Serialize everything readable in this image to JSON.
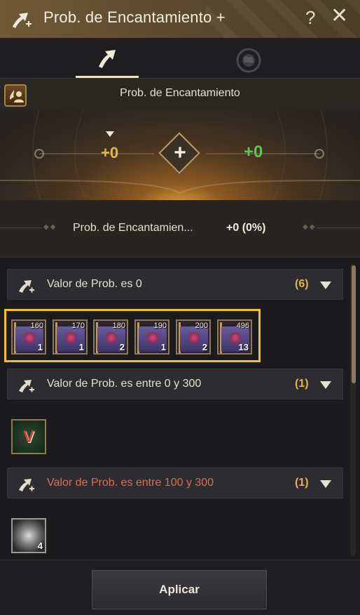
{
  "header": {
    "title": "Prob. de Encantamiento +",
    "icon": "enchant-arrow-plus-icon",
    "help_label": "?",
    "close_label": "✕"
  },
  "tabs": [
    {
      "icon": "enchant-arrow-icon",
      "active": true
    },
    {
      "icon": "globe-icon",
      "active": false
    }
  ],
  "subheader": {
    "icon": "enchant-user-icon",
    "title": "Prob. de Encantamiento"
  },
  "enchant": {
    "current": "+0",
    "result": "+0",
    "plus_label": "+"
  },
  "summary": {
    "label": "Prob. de Encantamien...",
    "value": "+0 (0%)"
  },
  "groups": [
    {
      "label": "Valor de Prob. es 0",
      "count": "(6)",
      "items": [
        {
          "level": "160",
          "qty": "1"
        },
        {
          "level": "170",
          "qty": "1"
        },
        {
          "level": "180",
          "qty": "2"
        },
        {
          "level": "190",
          "qty": "1"
        },
        {
          "level": "200",
          "qty": "2"
        },
        {
          "level": "496",
          "qty": "13"
        }
      ]
    },
    {
      "label": "Valor de Prob. es entre 0 y 300",
      "count": "(1)",
      "items": [
        {
          "glyph": "V"
        }
      ]
    },
    {
      "label": "Valor de Prob. es entre 100 y 300",
      "count": "(1)",
      "items": [
        {
          "qty": "4"
        }
      ]
    }
  ],
  "footer": {
    "apply_label": "Aplicar"
  },
  "colors": {
    "accent_gold": "#e2b34f",
    "success_green": "#56c94e",
    "warning_red": "#e06a5a",
    "highlight_yellow": "#f3c318"
  }
}
